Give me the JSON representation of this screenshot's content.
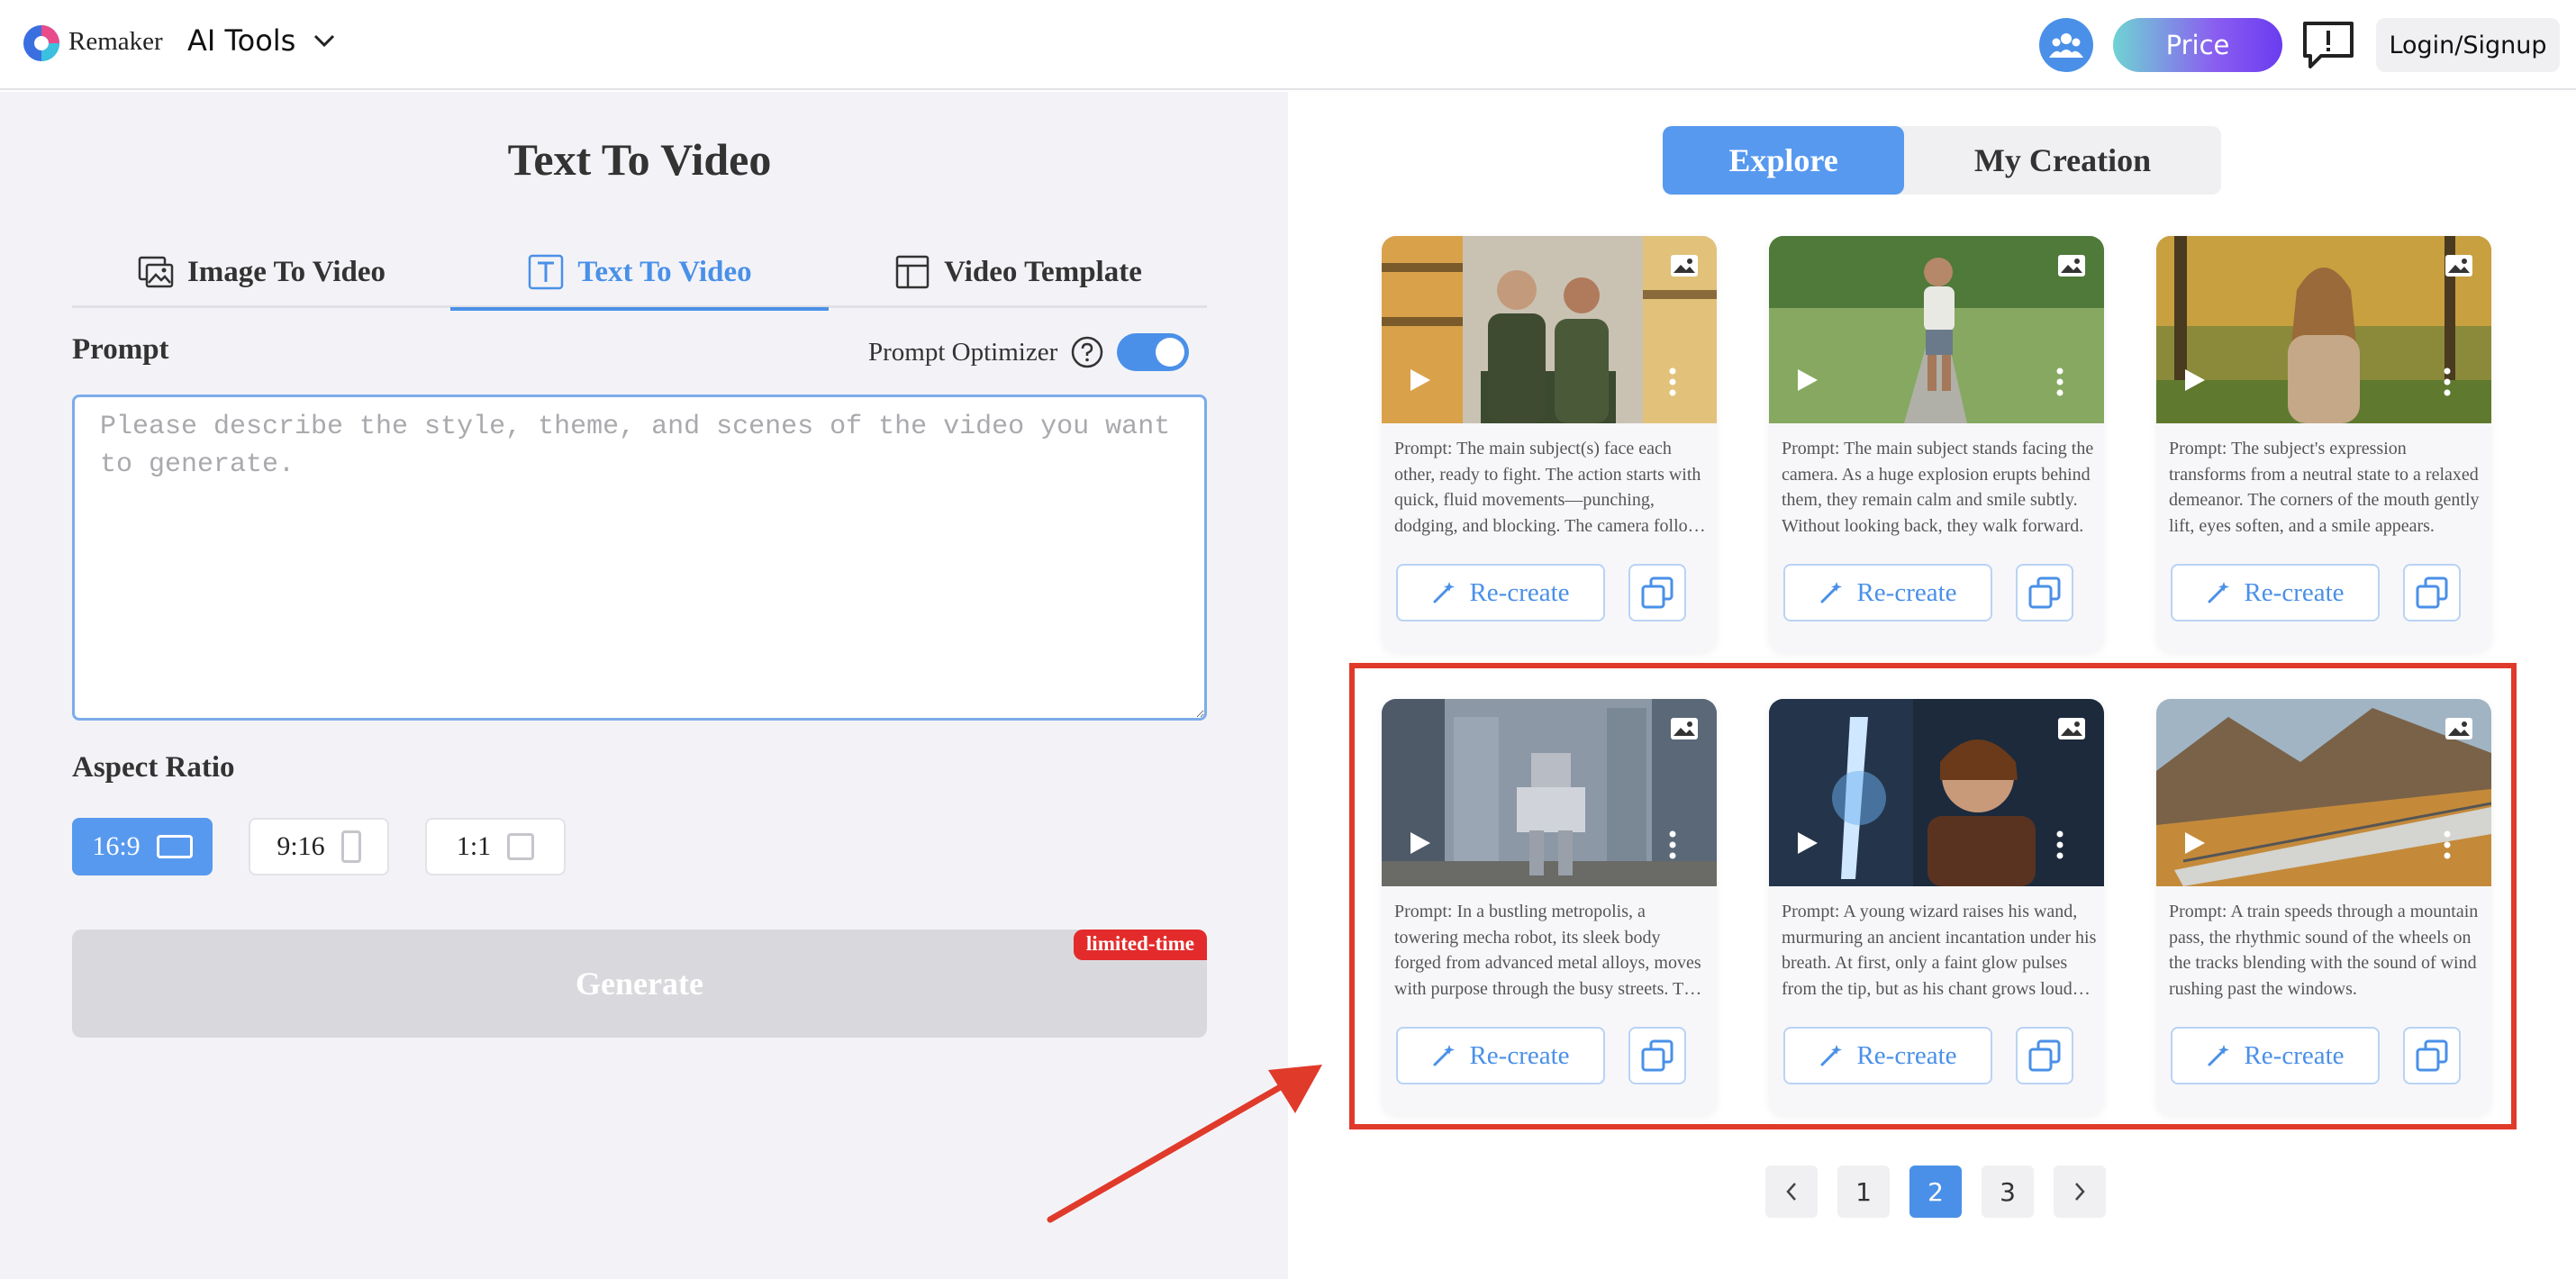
{
  "header": {
    "brand": "Remaker",
    "menu_label": "AI Tools",
    "price_label": "Price",
    "login_label": "Login/Signup",
    "accent": "#4a90e8"
  },
  "left": {
    "title": "Text To Video",
    "tabs": [
      {
        "label": "Image To Video",
        "icon": "image-video-icon",
        "active": false
      },
      {
        "label": "Text To Video",
        "icon": "text-t-icon",
        "active": true
      },
      {
        "label": "Video Template",
        "icon": "template-layout-icon",
        "active": false
      }
    ],
    "prompt_label": "Prompt",
    "optimizer_label": "Prompt Optimizer",
    "optimizer_enabled": true,
    "prompt_placeholder": "Please describe the style, theme, and scenes of the video you want to generate.",
    "prompt_value": "",
    "aspect_label": "Aspect Ratio",
    "ratios": [
      {
        "label": "16:9",
        "active": true
      },
      {
        "label": "9:16",
        "active": false
      },
      {
        "label": "1:1",
        "active": false
      }
    ],
    "generate_label": "Generate",
    "badge_label": "limited-time"
  },
  "right": {
    "tabs": [
      {
        "label": "Explore",
        "active": true
      },
      {
        "label": "My Creation",
        "active": false
      }
    ],
    "recreate_label": "Re-create",
    "cards": [
      {
        "prompt": "Prompt: The main subject(s) face each other, ready to fight. The action starts with quick, fluid movements—punching, dodging, and blocking. The camera follows the fight closely.",
        "scene": "couple-in-supermarket"
      },
      {
        "prompt": "Prompt: The main subject stands facing the camera. As a huge explosion erupts behind them, they remain calm and smile subtly. Without looking back, they walk forward.",
        "scene": "man-walking-in-park"
      },
      {
        "prompt": "Prompt: The subject's expression transforms from a neutral state to a relaxed demeanor. The corners of the mouth gently lift, eyes soften, and a smile appears.",
        "scene": "woman-in-autumn-park"
      },
      {
        "prompt": "Prompt: In a bustling metropolis, a towering mecha robot, its sleek body forged from advanced metal alloys, moves with purpose through the busy streets. The crowd stares.",
        "scene": "mecha-robot-in-city"
      },
      {
        "prompt": "Prompt: A young wizard raises his wand, murmuring an ancient incantation under his breath. At first, only a faint glow pulses from the tip, but as his chant grows louder it blazes.",
        "scene": "young-wizard-with-wand"
      },
      {
        "prompt": "Prompt: A train speeds through a mountain pass, the rhythmic sound of the wheels on the tracks blending with the sound of wind rushing past the windows.",
        "scene": "train-in-mountain-pass"
      }
    ],
    "pages": [
      "1",
      "2",
      "3"
    ],
    "current_page": "2"
  },
  "annotation": {
    "highlight_color": "#e03a2a"
  }
}
